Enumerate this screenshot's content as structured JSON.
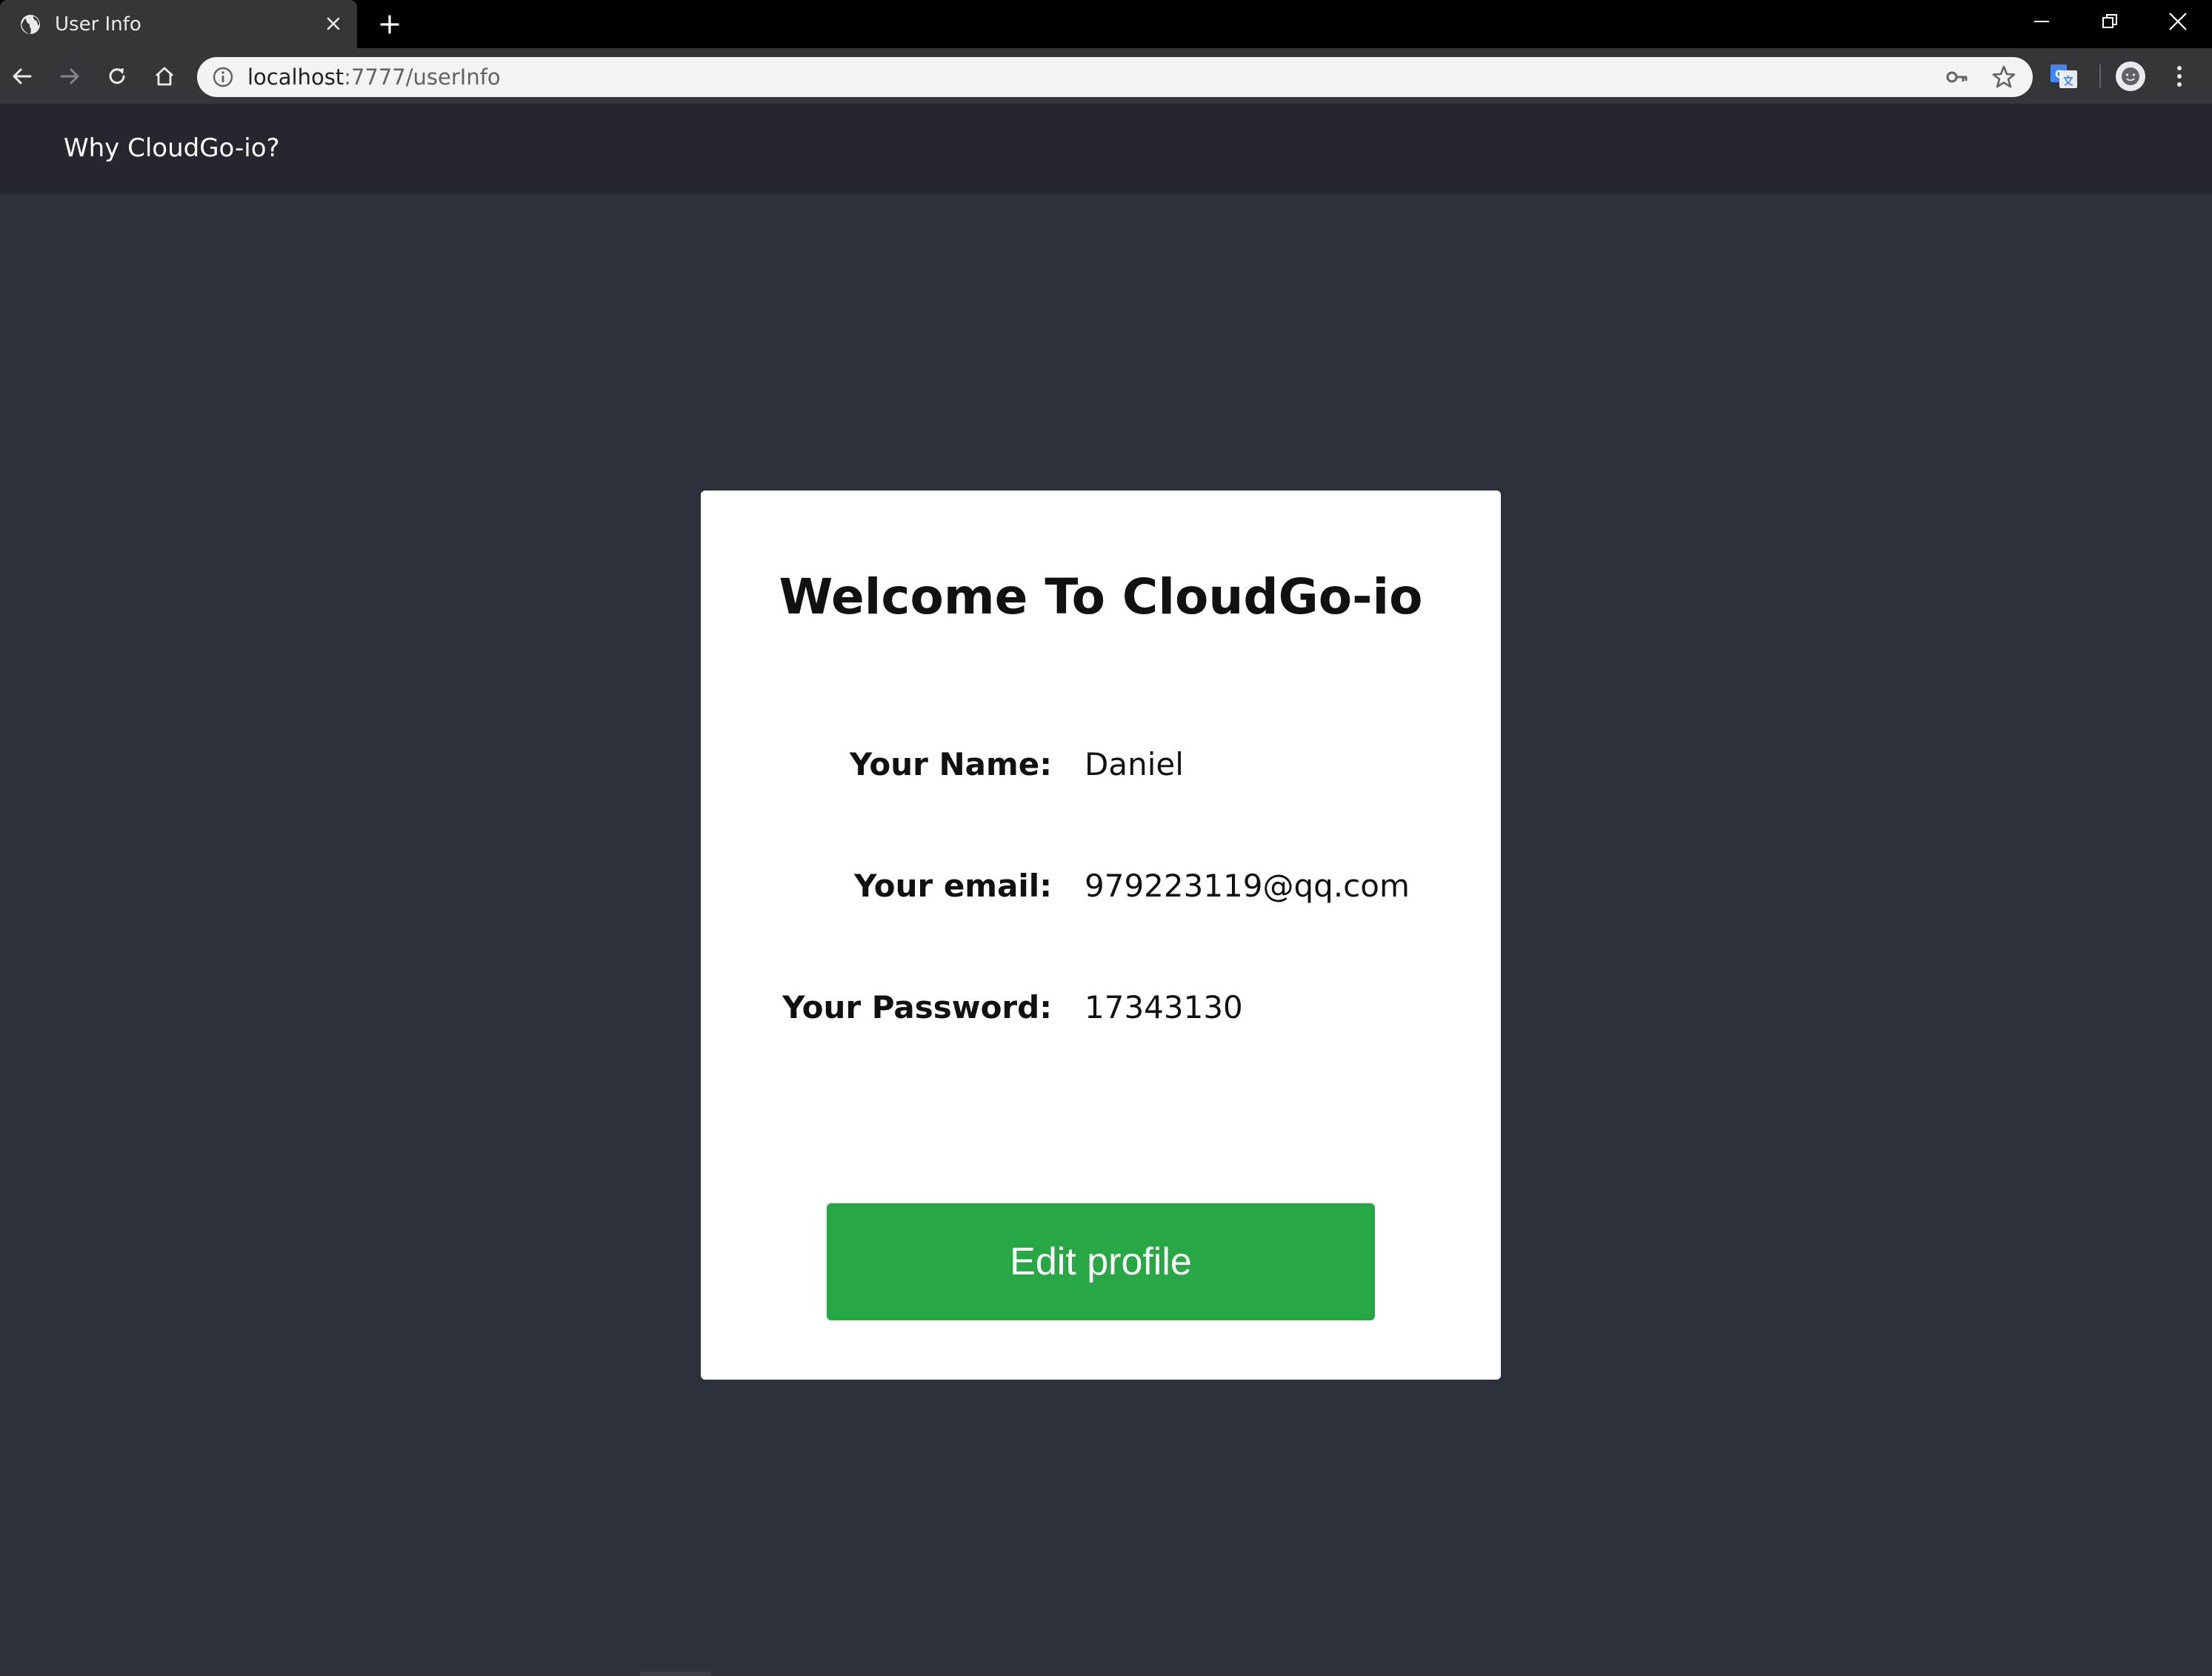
{
  "browser": {
    "tab": {
      "title": "User Info"
    },
    "address_bar": {
      "host": "localhost",
      "rest": ":7777/userInfo"
    }
  },
  "navbar": {
    "link_label": "Why CloudGo-io?"
  },
  "card": {
    "title": "Welcome To CloudGo-io",
    "fields": [
      {
        "label": "Your Name:",
        "value": "Daniel"
      },
      {
        "label": "Your email:",
        "value": "979223119@qq.com"
      },
      {
        "label": "Your Password:",
        "value": "17343130"
      }
    ],
    "edit_button_label": "Edit profile"
  },
  "colors": {
    "page_background": "#2c313a",
    "navbar_background": "#24282e",
    "card_background": "#ffffff",
    "button_green": "#28a745"
  }
}
